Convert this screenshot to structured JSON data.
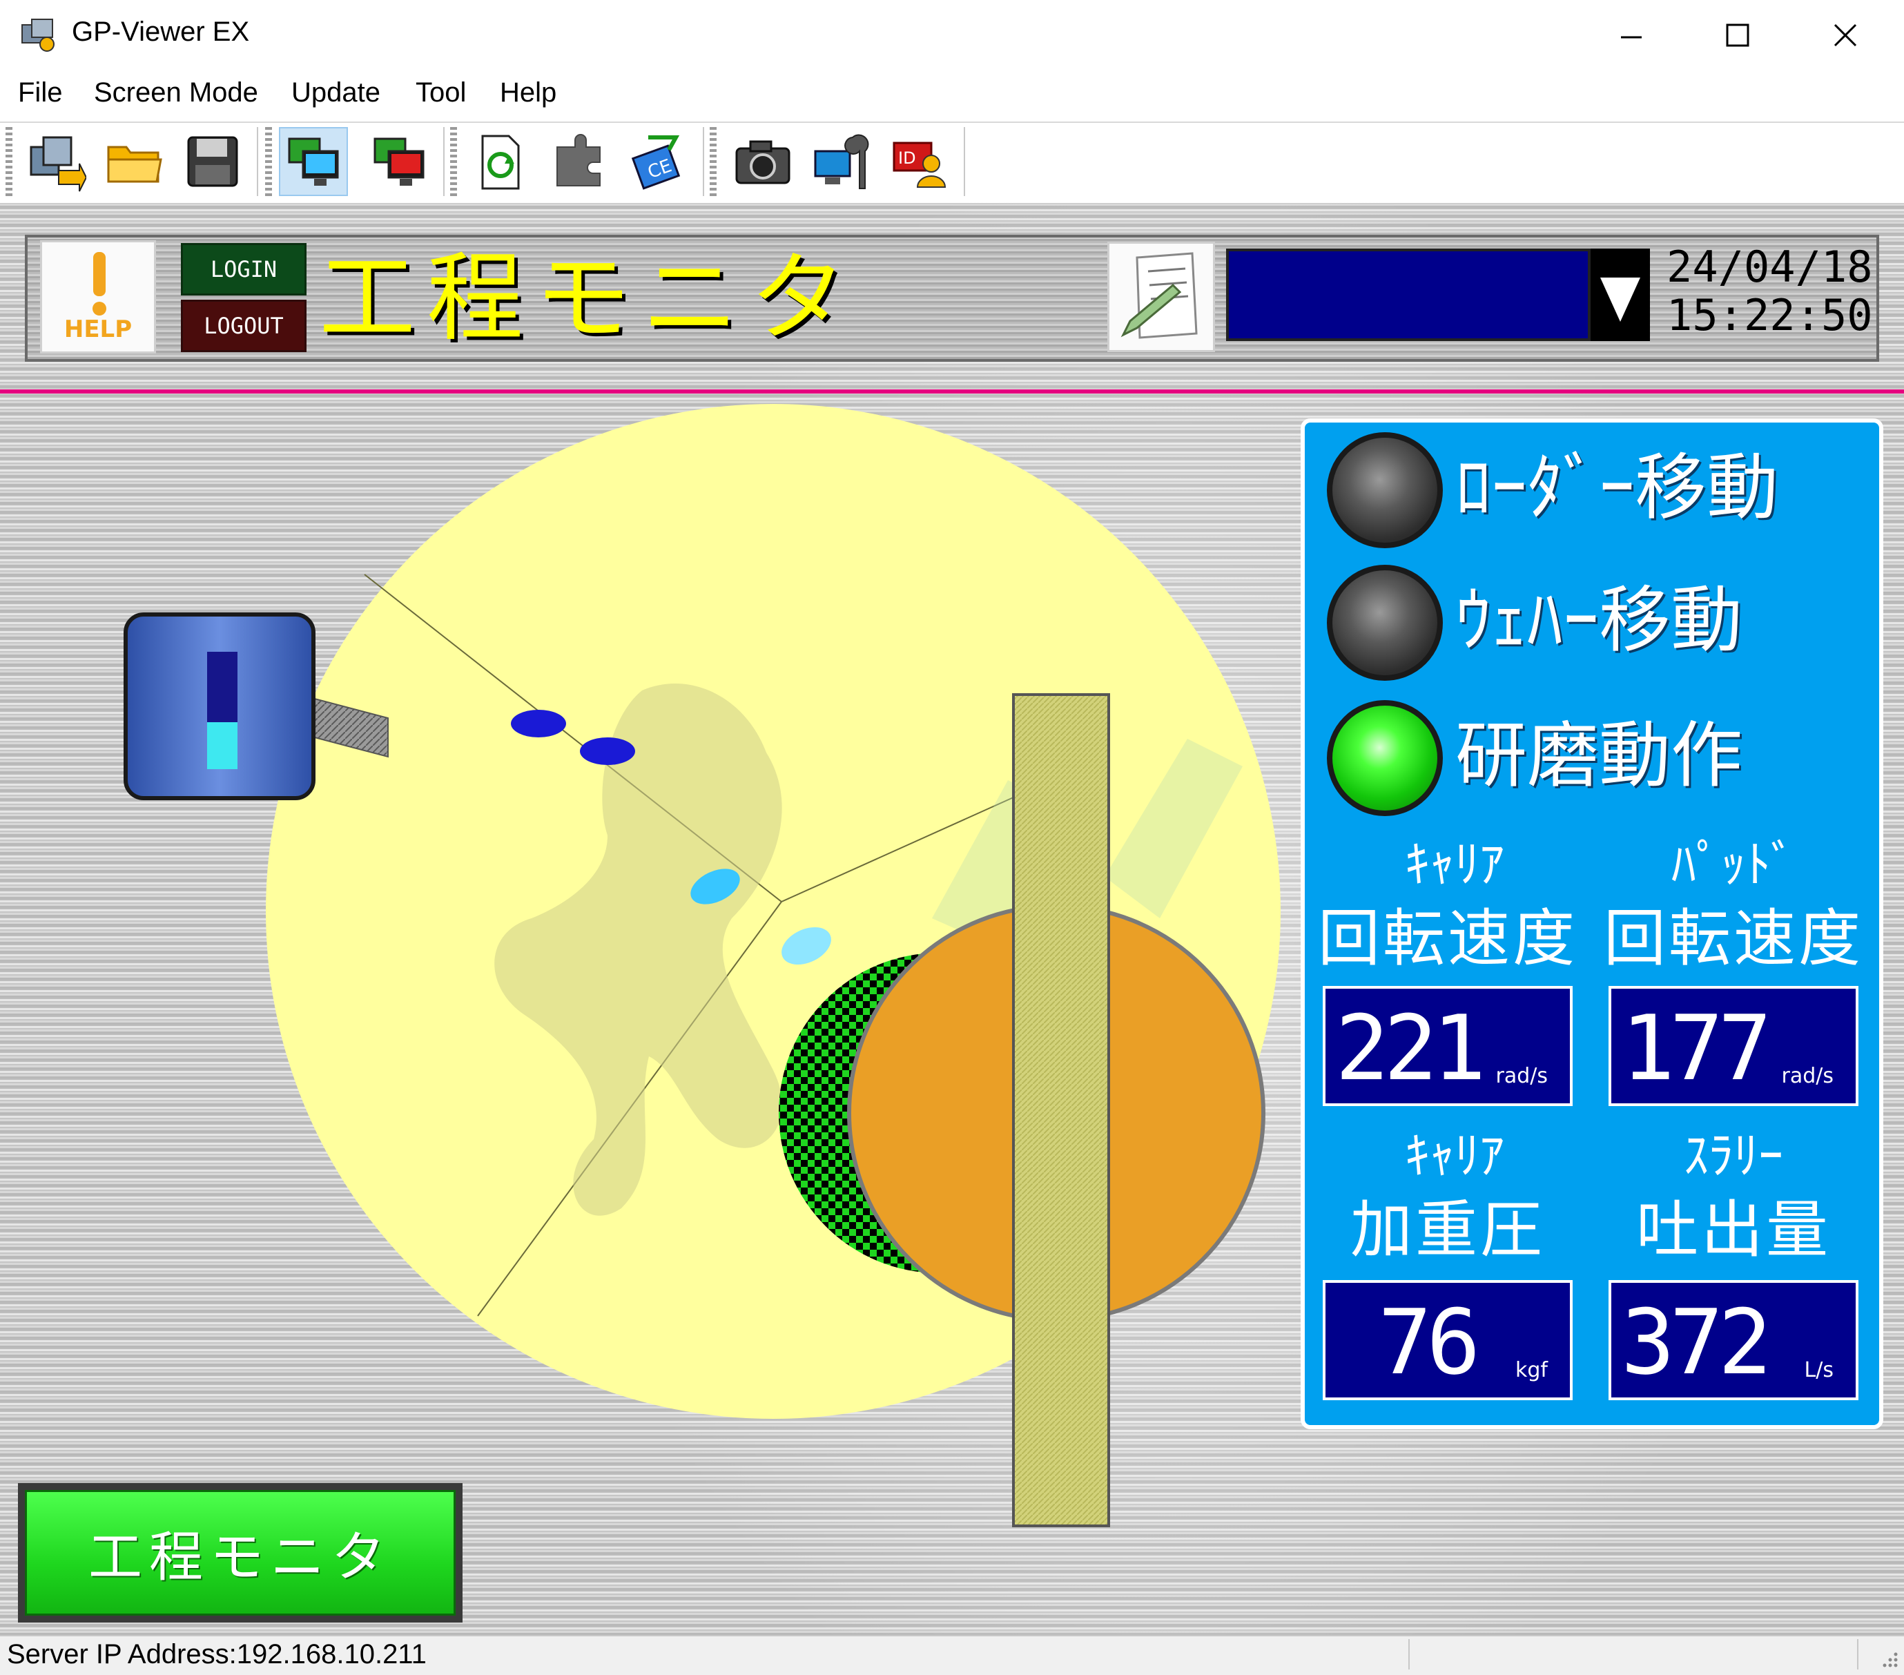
{
  "window": {
    "title": "GP-Viewer EX"
  },
  "menu": {
    "items": [
      "File",
      "Screen Mode",
      "Update",
      "Tool",
      "Help"
    ]
  },
  "toolbar": {
    "buttons": [
      "connect-icon",
      "open-folder-icon",
      "save-icon",
      "screen-mode-full-icon",
      "screen-mode-window-icon",
      "refresh-screen-icon",
      "plugin-icon",
      "ce-transfer-icon",
      "camera-icon",
      "settings-tool-icon",
      "id-user-icon"
    ]
  },
  "header": {
    "help_label": "HELP",
    "login_label": "LOGIN",
    "logout_label": "LOGOUT",
    "screen_title": "工程モニタ",
    "date": "24/04/18",
    "time": "15:22:50"
  },
  "status_panel": {
    "lamps": [
      {
        "label": "ﾛｰﾀﾞｰ移動",
        "state": "off"
      },
      {
        "label": "ｳｪﾊｰ移動",
        "state": "off"
      },
      {
        "label": "研磨動作",
        "state": "on"
      }
    ],
    "readouts": [
      {
        "label_kana": "ｷｬﾘｱ",
        "label_kanji": "回転速度",
        "value": "221",
        "unit": "rad/s"
      },
      {
        "label_kana": "ﾊﾟｯﾄﾞ",
        "label_kanji": "回転速度",
        "value": "177",
        "unit": "rad/s"
      },
      {
        "label_kana": "ｷｬﾘｱ",
        "label_kanji": "加重圧",
        "value": "76",
        "unit": "kgf"
      },
      {
        "label_kana": "ｽﾗﾘｰ",
        "label_kanji": "吐出量",
        "value": "372",
        "unit": "L/s"
      }
    ]
  },
  "tank": {
    "level_fraction": 0.4
  },
  "nav": {
    "process_monitor_label": "工程モニタ"
  },
  "statusbar": {
    "server_ip": "Server IP Address:192.168.10.211"
  },
  "colors": {
    "accent_magenta": "#e5007f",
    "panel_blue": "#00a0ef",
    "value_navy": "#00008b",
    "title_yellow": "#ffff00",
    "lamp_green": "#13c60b",
    "pad_yellow": "#ffff9e",
    "carrier_orange": "#ea9f26"
  }
}
